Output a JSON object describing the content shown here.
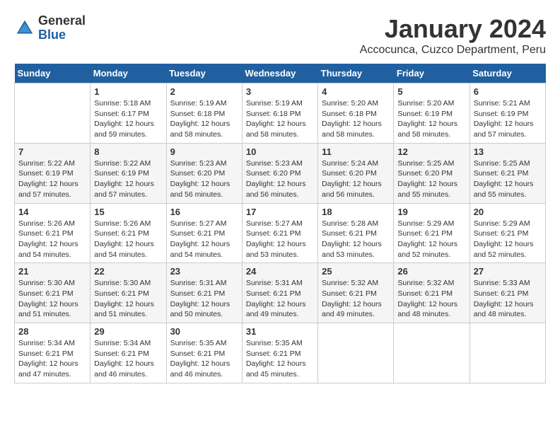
{
  "logo": {
    "general": "General",
    "blue": "Blue"
  },
  "header": {
    "title": "January 2024",
    "subtitle": "Accocunca, Cuzco Department, Peru"
  },
  "weekdays": [
    "Sunday",
    "Monday",
    "Tuesday",
    "Wednesday",
    "Thursday",
    "Friday",
    "Saturday"
  ],
  "weeks": [
    [
      {
        "day": "",
        "info": ""
      },
      {
        "day": "1",
        "info": "Sunrise: 5:18 AM\nSunset: 6:17 PM\nDaylight: 12 hours\nand 59 minutes."
      },
      {
        "day": "2",
        "info": "Sunrise: 5:19 AM\nSunset: 6:18 PM\nDaylight: 12 hours\nand 58 minutes."
      },
      {
        "day": "3",
        "info": "Sunrise: 5:19 AM\nSunset: 6:18 PM\nDaylight: 12 hours\nand 58 minutes."
      },
      {
        "day": "4",
        "info": "Sunrise: 5:20 AM\nSunset: 6:18 PM\nDaylight: 12 hours\nand 58 minutes."
      },
      {
        "day": "5",
        "info": "Sunrise: 5:20 AM\nSunset: 6:19 PM\nDaylight: 12 hours\nand 58 minutes."
      },
      {
        "day": "6",
        "info": "Sunrise: 5:21 AM\nSunset: 6:19 PM\nDaylight: 12 hours\nand 57 minutes."
      }
    ],
    [
      {
        "day": "7",
        "info": "Sunrise: 5:22 AM\nSunset: 6:19 PM\nDaylight: 12 hours\nand 57 minutes."
      },
      {
        "day": "8",
        "info": "Sunrise: 5:22 AM\nSunset: 6:19 PM\nDaylight: 12 hours\nand 57 minutes."
      },
      {
        "day": "9",
        "info": "Sunrise: 5:23 AM\nSunset: 6:20 PM\nDaylight: 12 hours\nand 56 minutes."
      },
      {
        "day": "10",
        "info": "Sunrise: 5:23 AM\nSunset: 6:20 PM\nDaylight: 12 hours\nand 56 minutes."
      },
      {
        "day": "11",
        "info": "Sunrise: 5:24 AM\nSunset: 6:20 PM\nDaylight: 12 hours\nand 56 minutes."
      },
      {
        "day": "12",
        "info": "Sunrise: 5:25 AM\nSunset: 6:20 PM\nDaylight: 12 hours\nand 55 minutes."
      },
      {
        "day": "13",
        "info": "Sunrise: 5:25 AM\nSunset: 6:21 PM\nDaylight: 12 hours\nand 55 minutes."
      }
    ],
    [
      {
        "day": "14",
        "info": "Sunrise: 5:26 AM\nSunset: 6:21 PM\nDaylight: 12 hours\nand 54 minutes."
      },
      {
        "day": "15",
        "info": "Sunrise: 5:26 AM\nSunset: 6:21 PM\nDaylight: 12 hours\nand 54 minutes."
      },
      {
        "day": "16",
        "info": "Sunrise: 5:27 AM\nSunset: 6:21 PM\nDaylight: 12 hours\nand 54 minutes."
      },
      {
        "day": "17",
        "info": "Sunrise: 5:27 AM\nSunset: 6:21 PM\nDaylight: 12 hours\nand 53 minutes."
      },
      {
        "day": "18",
        "info": "Sunrise: 5:28 AM\nSunset: 6:21 PM\nDaylight: 12 hours\nand 53 minutes."
      },
      {
        "day": "19",
        "info": "Sunrise: 5:29 AM\nSunset: 6:21 PM\nDaylight: 12 hours\nand 52 minutes."
      },
      {
        "day": "20",
        "info": "Sunrise: 5:29 AM\nSunset: 6:21 PM\nDaylight: 12 hours\nand 52 minutes."
      }
    ],
    [
      {
        "day": "21",
        "info": "Sunrise: 5:30 AM\nSunset: 6:21 PM\nDaylight: 12 hours\nand 51 minutes."
      },
      {
        "day": "22",
        "info": "Sunrise: 5:30 AM\nSunset: 6:21 PM\nDaylight: 12 hours\nand 51 minutes."
      },
      {
        "day": "23",
        "info": "Sunrise: 5:31 AM\nSunset: 6:21 PM\nDaylight: 12 hours\nand 50 minutes."
      },
      {
        "day": "24",
        "info": "Sunrise: 5:31 AM\nSunset: 6:21 PM\nDaylight: 12 hours\nand 49 minutes."
      },
      {
        "day": "25",
        "info": "Sunrise: 5:32 AM\nSunset: 6:21 PM\nDaylight: 12 hours\nand 49 minutes."
      },
      {
        "day": "26",
        "info": "Sunrise: 5:32 AM\nSunset: 6:21 PM\nDaylight: 12 hours\nand 48 minutes."
      },
      {
        "day": "27",
        "info": "Sunrise: 5:33 AM\nSunset: 6:21 PM\nDaylight: 12 hours\nand 48 minutes."
      }
    ],
    [
      {
        "day": "28",
        "info": "Sunrise: 5:34 AM\nSunset: 6:21 PM\nDaylight: 12 hours\nand 47 minutes."
      },
      {
        "day": "29",
        "info": "Sunrise: 5:34 AM\nSunset: 6:21 PM\nDaylight: 12 hours\nand 46 minutes."
      },
      {
        "day": "30",
        "info": "Sunrise: 5:35 AM\nSunset: 6:21 PM\nDaylight: 12 hours\nand 46 minutes."
      },
      {
        "day": "31",
        "info": "Sunrise: 5:35 AM\nSunset: 6:21 PM\nDaylight: 12 hours\nand 45 minutes."
      },
      {
        "day": "",
        "info": ""
      },
      {
        "day": "",
        "info": ""
      },
      {
        "day": "",
        "info": ""
      }
    ]
  ]
}
